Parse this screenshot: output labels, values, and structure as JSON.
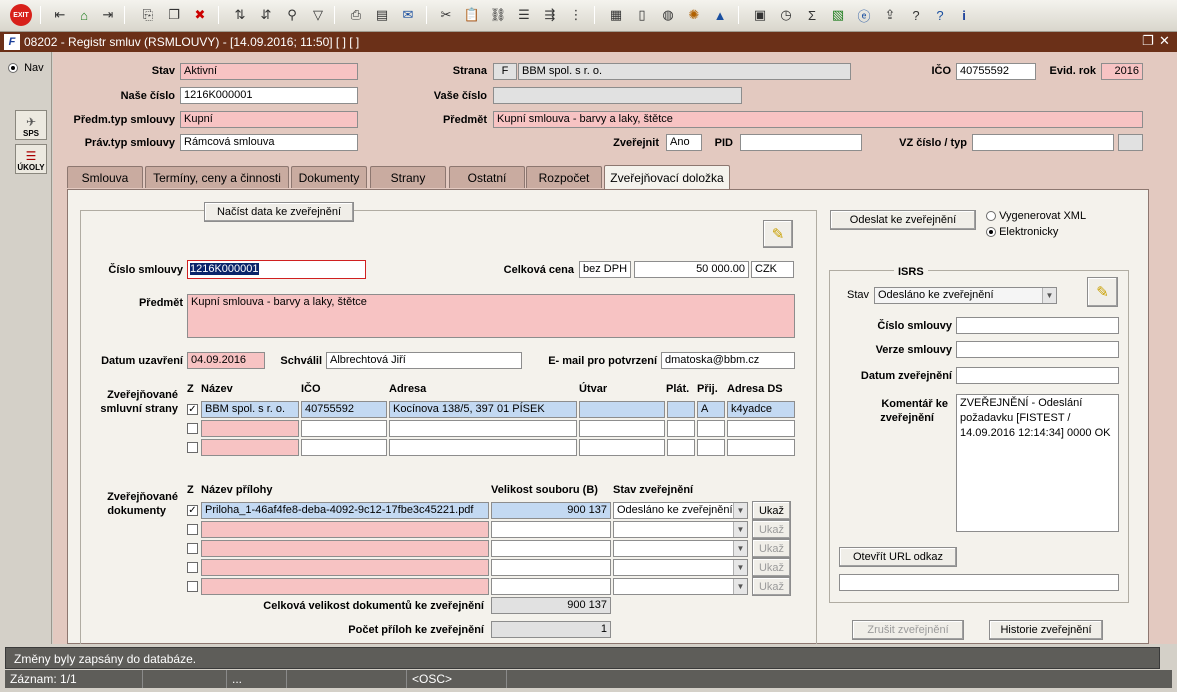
{
  "toolbar": {
    "exit_label": "EXIT"
  },
  "window": {
    "title": "08202 - Registr smluv (RSMLOUVY) - [14.09.2016; 11:50] [ ] [ ]"
  },
  "nav": {
    "label": "Nav",
    "sps_label": "SPS",
    "ukoly_label": "ÚKOLY"
  },
  "header": {
    "stav_label": "Stav",
    "stav_value": "Aktivní",
    "nase_cislo_label": "Naše číslo",
    "nase_cislo_value": "1216K000001",
    "predm_typ_label": "Předm.typ smlouvy",
    "predm_typ_value": "Kupní",
    "prav_typ_label": "Práv.typ smlouvy",
    "prav_typ_value": "Rámcová smlouva",
    "strana_label": "Strana",
    "strana_type": "F",
    "strana_value": "BBM spol. s r. o.",
    "vase_cislo_label": "Vaše číslo",
    "vase_cislo_value": "",
    "predmet_label": "Předmět",
    "predmet_value": "Kupní smlouva - barvy a laky, štětce",
    "zverejnit_label": "Zveřejnit",
    "zverejnit_value": "Ano",
    "pid_label": "PID",
    "pid_value": "",
    "vz_label": "VZ číslo / typ",
    "vz_value": "",
    "ico_label": "IČO",
    "ico_value": "40755592",
    "evid_rok_label": "Evid. rok",
    "evid_rok_value": "2016"
  },
  "tabs": [
    {
      "label": "Smlouva"
    },
    {
      "label": "Termíny, ceny a činnosti"
    },
    {
      "label": "Dokumenty"
    },
    {
      "label": "Strany"
    },
    {
      "label": "Ostatní"
    },
    {
      "label": "Rozpočet"
    },
    {
      "label": "Zveřejňovací doložka"
    }
  ],
  "form": {
    "nacist_button": "Načíst data ke zveřejnění",
    "cislo_smlouvy_label": "Číslo smlouvy",
    "cislo_smlouvy_value": "1216K000001",
    "celkova_cena_label": "Celková cena",
    "cena_typ": "bez DPH",
    "cena_value": "50 000.00",
    "mena": "CZK",
    "predmet_label": "Předmět",
    "predmet_value": "Kupní smlouva - barvy a laky, štětce",
    "datum_uzavreni_label": "Datum uzavření",
    "datum_uzavreni_value": "04.09.2016",
    "schvalil_label": "Schválil",
    "schvalil_value": "Albrechtová Jiří",
    "email_label": "E- mail pro potvrzení",
    "email_value": "dmatoska@bbm.cz"
  },
  "parties": {
    "section_label_1": "Zveřejňované",
    "section_label_2": "smluvní strany",
    "columns": {
      "z": "Z",
      "nazev": "Název",
      "ico": "IČO",
      "adresa": "Adresa",
      "utvar": "Útvar",
      "plat": "Plát.",
      "prij": "Přij.",
      "adresa_ds": "Adresa DS"
    },
    "rows": [
      {
        "checked": true,
        "nazev": "BBM spol. s r. o.",
        "ico": "40755592",
        "adresa": "Kocínova 138/5, 397 01 PÍSEK",
        "utvar": "",
        "plat": "",
        "prij": "A",
        "adresa_ds": "k4yadce"
      },
      {
        "checked": false,
        "nazev": "",
        "ico": "",
        "adresa": "",
        "utvar": "",
        "plat": "",
        "prij": "",
        "adresa_ds": ""
      },
      {
        "checked": false,
        "nazev": "",
        "ico": "",
        "adresa": "",
        "utvar": "",
        "plat": "",
        "prij": "",
        "adresa_ds": ""
      }
    ]
  },
  "documents": {
    "section_label_1": "Zveřejňované",
    "section_label_2": "dokumenty",
    "columns": {
      "z": "Z",
      "nazev": "Název přílohy",
      "velikost": "Velikost souboru (B)",
      "stav": "Stav zveřejnění"
    },
    "ukaz_label": "Ukaž",
    "rows": [
      {
        "checked": true,
        "nazev": "Priloha_1-46af4fe8-deba-4092-9c12-17fbe3c45221.pdf",
        "velikost": "900 137",
        "stav": "Odesláno ke zveřejnění"
      },
      {
        "checked": false,
        "nazev": "",
        "velikost": "",
        "stav": ""
      },
      {
        "checked": false,
        "nazev": "",
        "velikost": "",
        "stav": ""
      },
      {
        "checked": false,
        "nazev": "",
        "velikost": "",
        "stav": ""
      },
      {
        "checked": false,
        "nazev": "",
        "velikost": "",
        "stav": ""
      }
    ],
    "total_size_label": "Celková velikost dokumentů ke zveřejnění",
    "total_size_value": "900 137",
    "count_label": "Počet příloh ke zveřejnění",
    "count_value": "1"
  },
  "right": {
    "odeslat_button": "Odeslat ke zveřejnění",
    "opt_xml": "Vygenerovat XML",
    "opt_elektronicky": "Elektronicky",
    "isrs_title": "ISRS",
    "stav_label": "Stav",
    "stav_value": "Odesláno ke zveřejnění",
    "cislo_smlouvy_label": "Číslo smlouvy",
    "cislo_smlouvy_value": "",
    "verze_label": "Verze smlouvy",
    "verze_value": "",
    "datum_zverejneni_label": "Datum zveřejnění",
    "datum_zverejneni_value": "",
    "komentar_label_1": "Komentář ke",
    "komentar_label_2": "zveřejnění",
    "komentar_value": "ZVEŘEJNĚNÍ - Odeslání požadavku [FISTEST / 14.09.2016 12:14:34] 0000 OK",
    "otevrit_button": "Otevřít URL odkaz",
    "url_value": "",
    "zrusit_button": "Zrušit zveřejnění",
    "historie_button": "Historie zveřejnění"
  },
  "status": {
    "message": "Změny byly zapsány do databáze.",
    "record": "Záznam: 1/1",
    "ellipsis": "...",
    "osc": "<OSC>"
  }
}
